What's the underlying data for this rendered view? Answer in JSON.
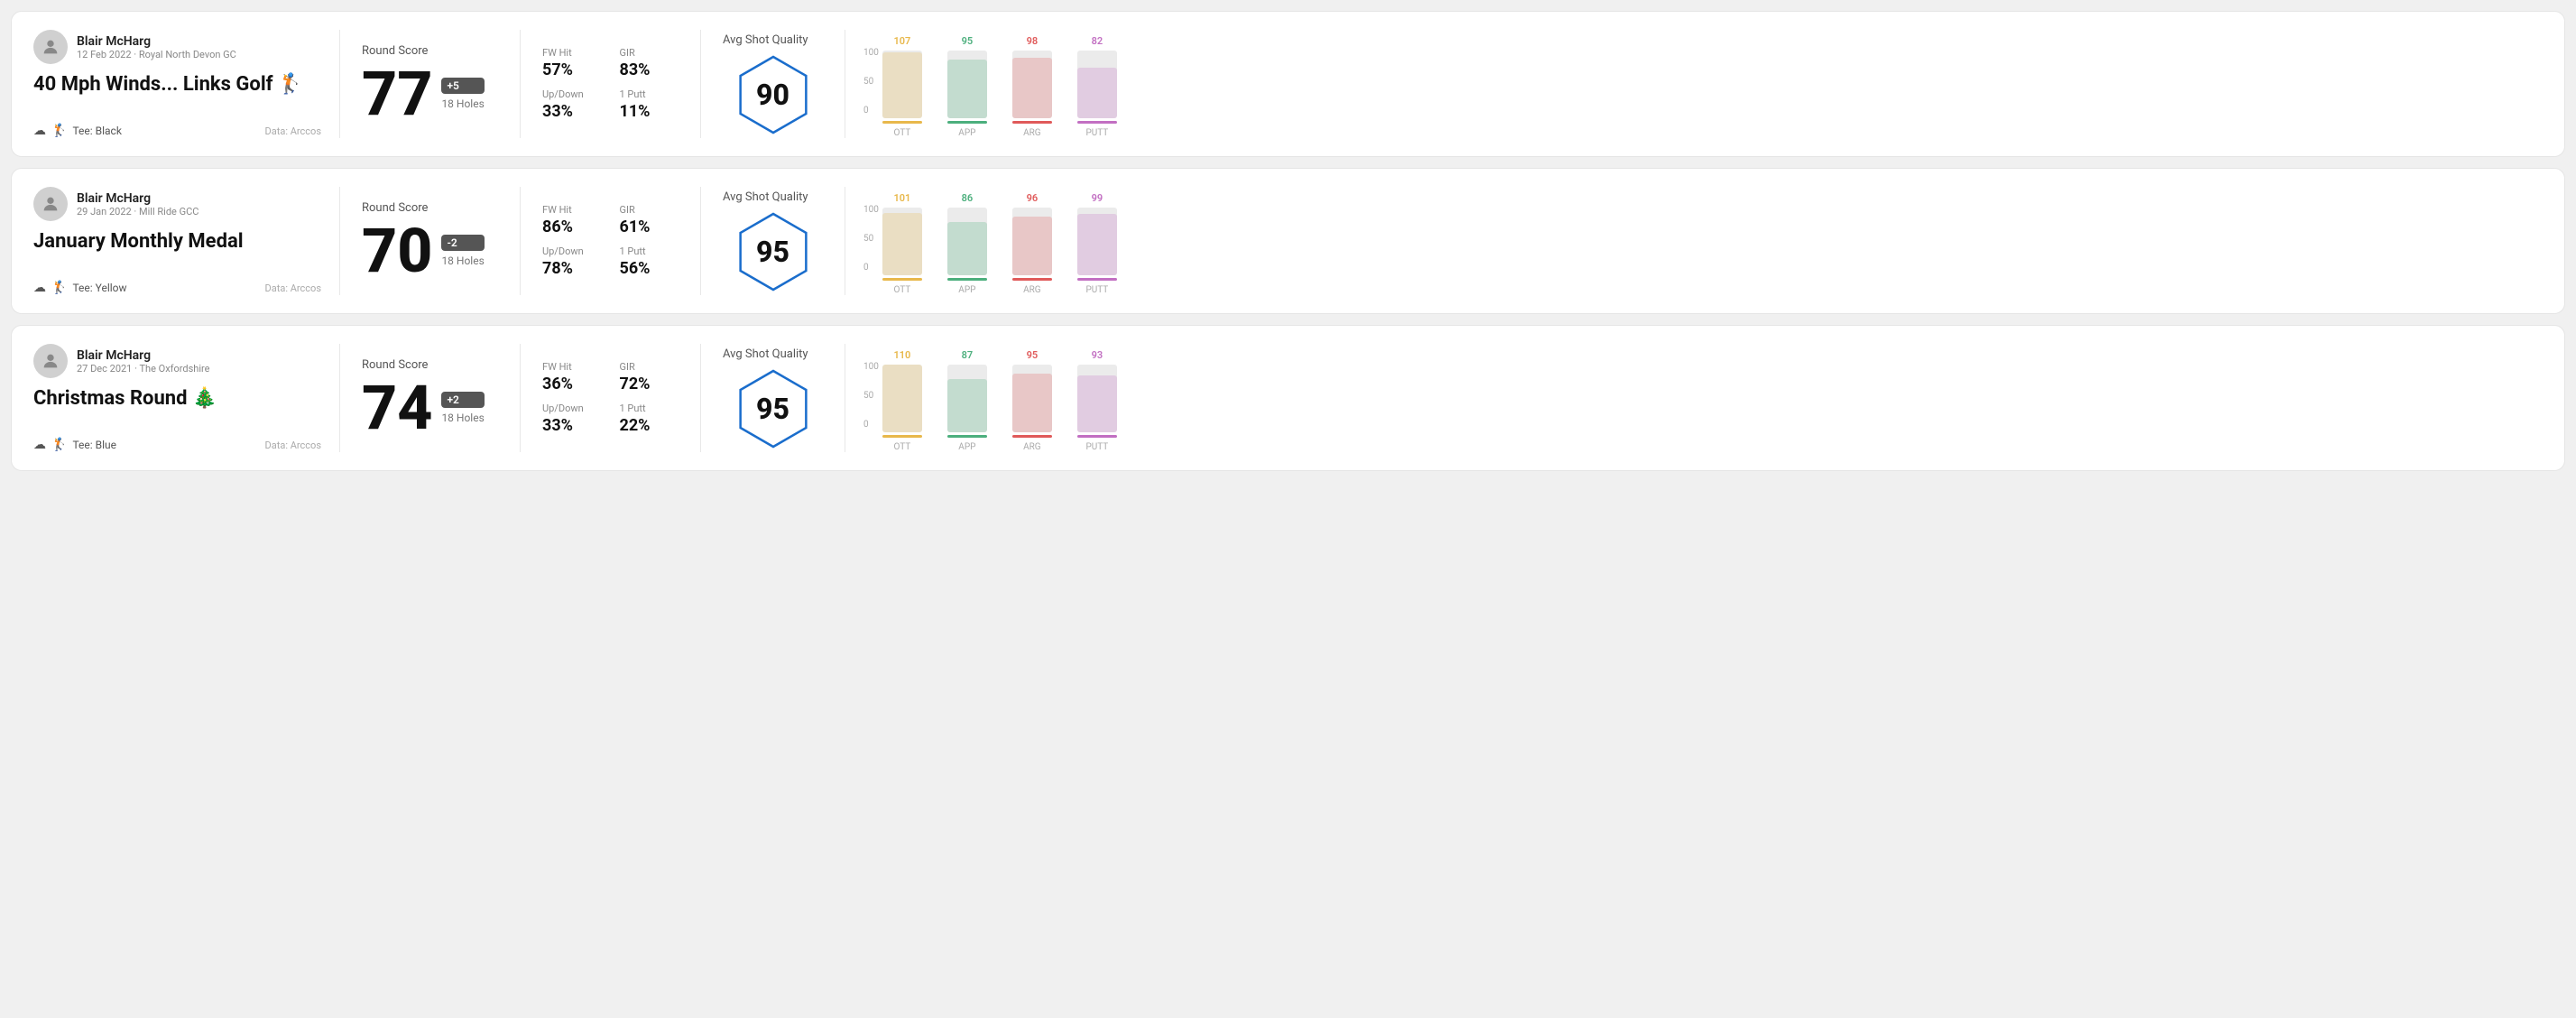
{
  "rounds": [
    {
      "id": "round1",
      "user": {
        "name": "Blair McHarg",
        "date": "12 Feb 2022 · Royal North Devon GC"
      },
      "title": "40 Mph Winds... Links Golf 🏌️",
      "tee": "Black",
      "dataSource": "Data: Arccos",
      "score": {
        "value": "77",
        "modifier": "+5",
        "holes": "18 Holes"
      },
      "stats": {
        "fwHit": {
          "label": "FW Hit",
          "value": "57%"
        },
        "gir": {
          "label": "GIR",
          "value": "83%"
        },
        "upDown": {
          "label": "Up/Down",
          "value": "33%"
        },
        "onePutt": {
          "label": "1 Putt",
          "value": "11%"
        }
      },
      "quality": {
        "label": "Avg Shot Quality",
        "score": "90"
      },
      "chart": {
        "bars": [
          {
            "label": "OTT",
            "value": 107,
            "maxDisplay": 100,
            "color": "#e8b84b"
          },
          {
            "label": "APP",
            "value": 95,
            "maxDisplay": 100,
            "color": "#4caf7d"
          },
          {
            "label": "ARG",
            "value": 98,
            "maxDisplay": 100,
            "color": "#e05a5a"
          },
          {
            "label": "PUTT",
            "value": 82,
            "maxDisplay": 100,
            "color": "#c26fc2"
          }
        ],
        "yLabels": [
          "100",
          "50",
          "0"
        ]
      }
    },
    {
      "id": "round2",
      "user": {
        "name": "Blair McHarg",
        "date": "29 Jan 2022 · Mill Ride GCC"
      },
      "title": "January Monthly Medal",
      "tee": "Yellow",
      "dataSource": "Data: Arccos",
      "score": {
        "value": "70",
        "modifier": "-2",
        "holes": "18 Holes"
      },
      "stats": {
        "fwHit": {
          "label": "FW Hit",
          "value": "86%"
        },
        "gir": {
          "label": "GIR",
          "value": "61%"
        },
        "upDown": {
          "label": "Up/Down",
          "value": "78%"
        },
        "onePutt": {
          "label": "1 Putt",
          "value": "56%"
        }
      },
      "quality": {
        "label": "Avg Shot Quality",
        "score": "95"
      },
      "chart": {
        "bars": [
          {
            "label": "OTT",
            "value": 101,
            "maxDisplay": 100,
            "color": "#e8b84b"
          },
          {
            "label": "APP",
            "value": 86,
            "maxDisplay": 100,
            "color": "#4caf7d"
          },
          {
            "label": "ARG",
            "value": 96,
            "maxDisplay": 100,
            "color": "#e05a5a"
          },
          {
            "label": "PUTT",
            "value": 99,
            "maxDisplay": 100,
            "color": "#c26fc2"
          }
        ],
        "yLabels": [
          "100",
          "50",
          "0"
        ]
      }
    },
    {
      "id": "round3",
      "user": {
        "name": "Blair McHarg",
        "date": "27 Dec 2021 · The Oxfordshire"
      },
      "title": "Christmas Round 🎄",
      "tee": "Blue",
      "dataSource": "Data: Arccos",
      "score": {
        "value": "74",
        "modifier": "+2",
        "holes": "18 Holes"
      },
      "stats": {
        "fwHit": {
          "label": "FW Hit",
          "value": "36%"
        },
        "gir": {
          "label": "GIR",
          "value": "72%"
        },
        "upDown": {
          "label": "Up/Down",
          "value": "33%"
        },
        "onePutt": {
          "label": "1 Putt",
          "value": "22%"
        }
      },
      "quality": {
        "label": "Avg Shot Quality",
        "score": "95"
      },
      "chart": {
        "bars": [
          {
            "label": "OTT",
            "value": 110,
            "maxDisplay": 100,
            "color": "#e8b84b"
          },
          {
            "label": "APP",
            "value": 87,
            "maxDisplay": 100,
            "color": "#4caf7d"
          },
          {
            "label": "ARG",
            "value": 95,
            "maxDisplay": 100,
            "color": "#e05a5a"
          },
          {
            "label": "PUTT",
            "value": 93,
            "maxDisplay": 100,
            "color": "#c26fc2"
          }
        ],
        "yLabels": [
          "100",
          "50",
          "0"
        ]
      }
    }
  ],
  "labels": {
    "roundScore": "Round Score",
    "avgShotQuality": "Avg Shot Quality",
    "dataArccos": "Data: Arccos"
  }
}
